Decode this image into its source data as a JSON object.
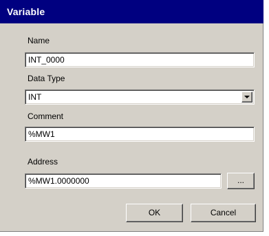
{
  "window": {
    "title": "Variable"
  },
  "fields": {
    "name": {
      "label": "Name",
      "value": "INT_0000"
    },
    "data_type": {
      "label": "Data Type",
      "value": "INT"
    },
    "comment": {
      "label": "Comment",
      "value": "%MW1"
    },
    "address": {
      "label": "Address",
      "value": "%MW1.0000000",
      "browse_label": "..."
    }
  },
  "buttons": {
    "ok": "OK",
    "cancel": "Cancel"
  },
  "colors": {
    "titlebar": "#000080",
    "dialog_bg": "#d4d0c8"
  },
  "icons": {
    "dropdown": "triangle-down-icon"
  }
}
